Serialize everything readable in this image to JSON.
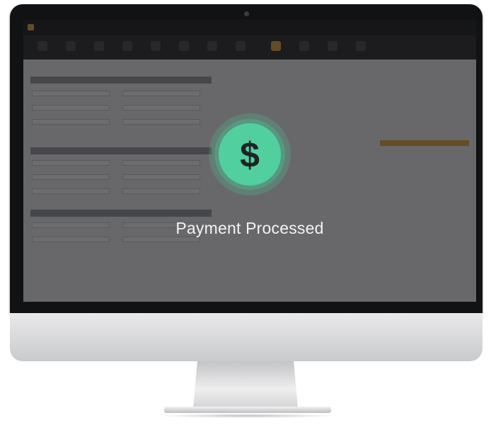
{
  "app": {
    "overlay_message": "Payment Processed",
    "icon": "dollar-icon",
    "accent_color": "#e6a83a",
    "success_color": "#52cf9f"
  }
}
